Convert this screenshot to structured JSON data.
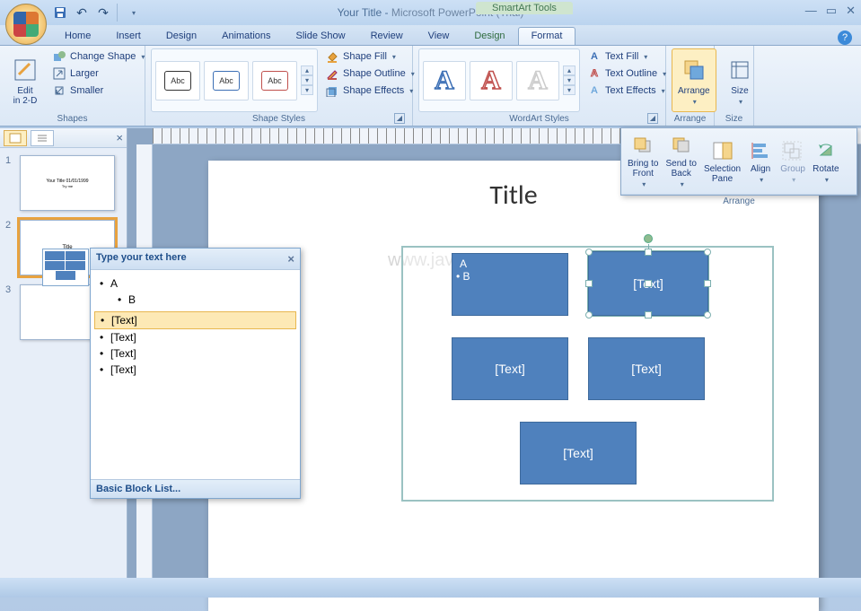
{
  "title": {
    "doc": "Your Title",
    "app": "Microsoft PowerPoint (Trial)"
  },
  "contextual_label": "SmartArt Tools",
  "tabs": [
    "Home",
    "Insert",
    "Design",
    "Animations",
    "Slide Show",
    "Review",
    "View",
    "Design",
    "Format"
  ],
  "active_tab": 8,
  "ribbon": {
    "shapes": {
      "label": "Shapes",
      "edit2d": "Edit\nin 2-D",
      "change_shape": "Change Shape",
      "larger": "Larger",
      "smaller": "Smaller"
    },
    "shape_styles": {
      "label": "Shape Styles",
      "sample": "Abc",
      "fill": "Shape Fill",
      "outline": "Shape Outline",
      "effects": "Shape Effects"
    },
    "wordart": {
      "label": "WordArt Styles",
      "text_fill": "Text Fill",
      "text_outline": "Text Outline",
      "text_effects": "Text Effects"
    },
    "arrange": {
      "label": "Arrange",
      "btn": "Arrange"
    },
    "size": {
      "label": "Size",
      "btn": "Size"
    }
  },
  "arrange_popup": {
    "items": [
      "Bring to\nFront",
      "Send to\nBack",
      "Selection\nPane",
      "Align",
      "Group",
      "Rotate"
    ],
    "label": "Arrange"
  },
  "textpane": {
    "header": "Type your text here",
    "items": [
      {
        "lvl": 1,
        "txt": "A"
      },
      {
        "lvl": 2,
        "txt": "B"
      },
      {
        "lvl": 3,
        "txt": ""
      },
      {
        "lvl": 1,
        "txt": "[Text]",
        "sel": true
      },
      {
        "lvl": 1,
        "txt": "[Text]"
      },
      {
        "lvl": 1,
        "txt": "[Text]"
      },
      {
        "lvl": 1,
        "txt": "[Text]"
      }
    ],
    "footer": "Basic Block List..."
  },
  "slide": {
    "title": "Title",
    "watermark": "www.java2s.com",
    "blocks": {
      "b1": {
        "a": "A",
        "b": "B"
      },
      "b2": "[Text]",
      "b3": "[Text]",
      "b4": "[Text]",
      "b5": "[Text]"
    }
  },
  "thumbs": {
    "t1": "Your Title 01/01/1999",
    "t2": "Title"
  }
}
